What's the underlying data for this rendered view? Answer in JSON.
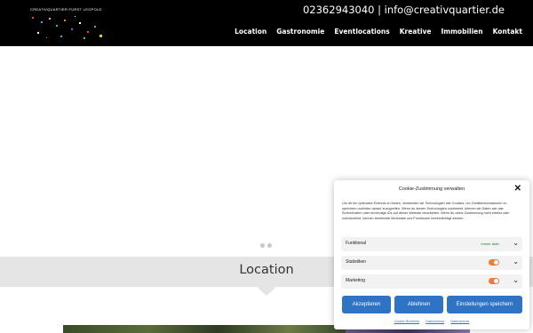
{
  "header": {
    "logo_text": "CREATIVQUARTIER FÜRST LEOPOLD",
    "contact": "02362943040 | info@creativquartier.de",
    "nav": [
      "Location",
      "Gastronomie",
      "Eventlocations",
      "Kreative",
      "Immobilien",
      "Kontakt"
    ]
  },
  "section": {
    "title": "Location"
  },
  "cookie": {
    "title": "Cookie-Zustimmung verwalten",
    "text": "Um dir ein optimales Erlebnis zu bieten, verwenden wir Technologien wie Cookies, um Geräteinformationen zu speichern und/oder darauf zuzugreifen. Wenn du diesen Technologien zustimmst, können wir Daten wie das Surfverhalten oder eindeutige IDs auf dieser Website verarbeiten. Wenn du deine Zustimmung nicht erteilst oder zurückziehst, können bestimmte Merkmale und Funktionen beeinträchtigt werden.",
    "rows": [
      {
        "label": "Funktional",
        "status": "Immer aktiv"
      },
      {
        "label": "Statistiken"
      },
      {
        "label": "Marketing"
      }
    ],
    "buttons": {
      "accept": "Akzeptieren",
      "deny": "Ablehnen",
      "settings": "Einstellungen speichern"
    },
    "links": [
      "Cookie-Richtlinie",
      "Datenschutz",
      "Datenschutz"
    ]
  },
  "colors": {
    "accent_blue": "#2e73c4",
    "toggle_orange": "#f07a3c",
    "status_green": "#1e8a1e"
  }
}
